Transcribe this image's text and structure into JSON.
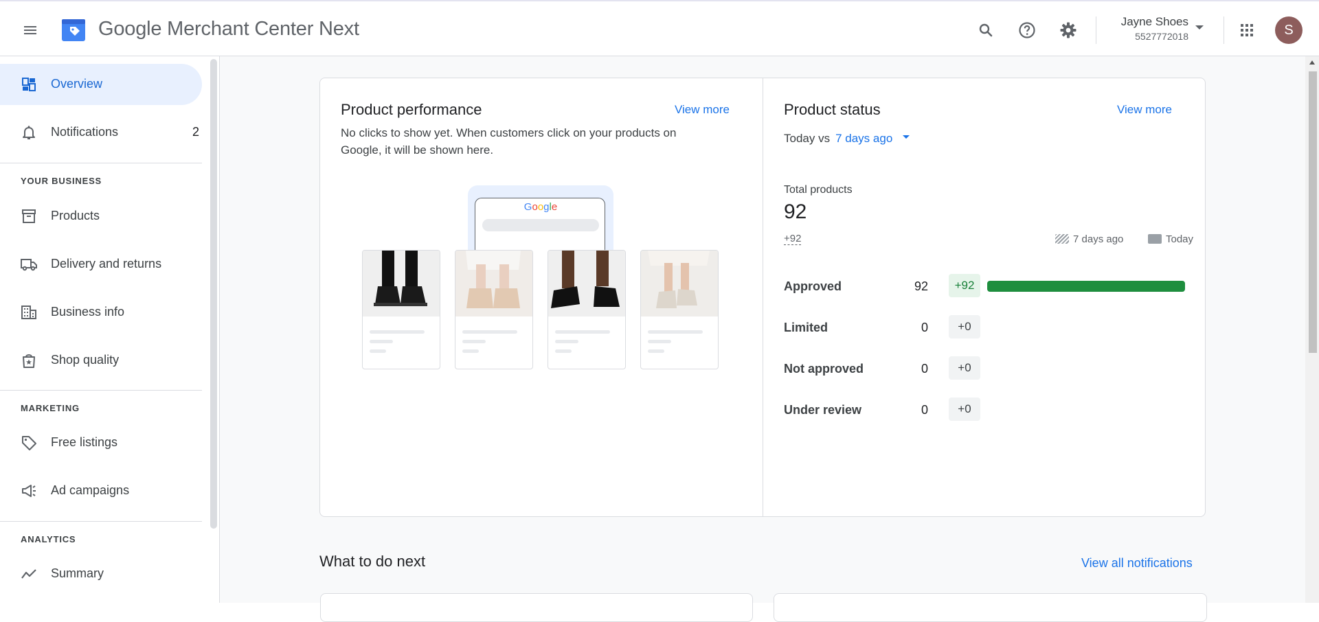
{
  "header": {
    "app_title": "Google Merchant Center Next",
    "account_name": "Jayne Shoes",
    "account_id": "5527772018",
    "avatar_letter": "S"
  },
  "sidebar": {
    "items_top": [
      {
        "label": "Overview",
        "icon": "dashboard-icon",
        "active": true
      },
      {
        "label": "Notifications",
        "icon": "bell-icon",
        "count": "2"
      }
    ],
    "your_business_title": "YOUR BUSINESS",
    "your_business": [
      {
        "label": "Products",
        "icon": "archive-box-icon"
      },
      {
        "label": "Delivery and returns",
        "icon": "truck-icon"
      },
      {
        "label": "Business info",
        "icon": "building-icon"
      },
      {
        "label": "Shop quality",
        "icon": "shopping-bag-star-icon"
      }
    ],
    "marketing_title": "MARKETING",
    "marketing": [
      {
        "label": "Free listings",
        "icon": "tag-icon"
      },
      {
        "label": "Ad campaigns",
        "icon": "megaphone-icon"
      }
    ],
    "analytics_title": "ANALYTICS",
    "analytics": [
      {
        "label": "Summary",
        "icon": "trend-line-icon"
      }
    ]
  },
  "performance": {
    "title": "Product performance",
    "view_more": "View more",
    "empty_text": "No clicks to show yet. When customers click on your products on Google, it will be shown here.",
    "phone_brand": "Google"
  },
  "status": {
    "title": "Product status",
    "view_more": "View more",
    "compare_prefix": "Today vs",
    "compare_range": "7 days ago",
    "total_label": "Total products",
    "total_value": "92",
    "total_delta": "+92",
    "legend_prev": "7 days ago",
    "legend_today": "Today",
    "rows": [
      {
        "label": "Approved",
        "value": "92",
        "delta": "+92",
        "fraction": 1.0
      },
      {
        "label": "Limited",
        "value": "0",
        "delta": "+0",
        "fraction": 0
      },
      {
        "label": "Not approved",
        "value": "0",
        "delta": "+0",
        "fraction": 0
      },
      {
        "label": "Under review",
        "value": "0",
        "delta": "+0",
        "fraction": 0
      }
    ]
  },
  "next": {
    "title": "What to do next",
    "view_all": "View all notifications"
  },
  "colors": {
    "accent": "#1a73e8",
    "active_nav_bg": "#e8f0fe",
    "approved_bar": "#1e8e3e"
  }
}
